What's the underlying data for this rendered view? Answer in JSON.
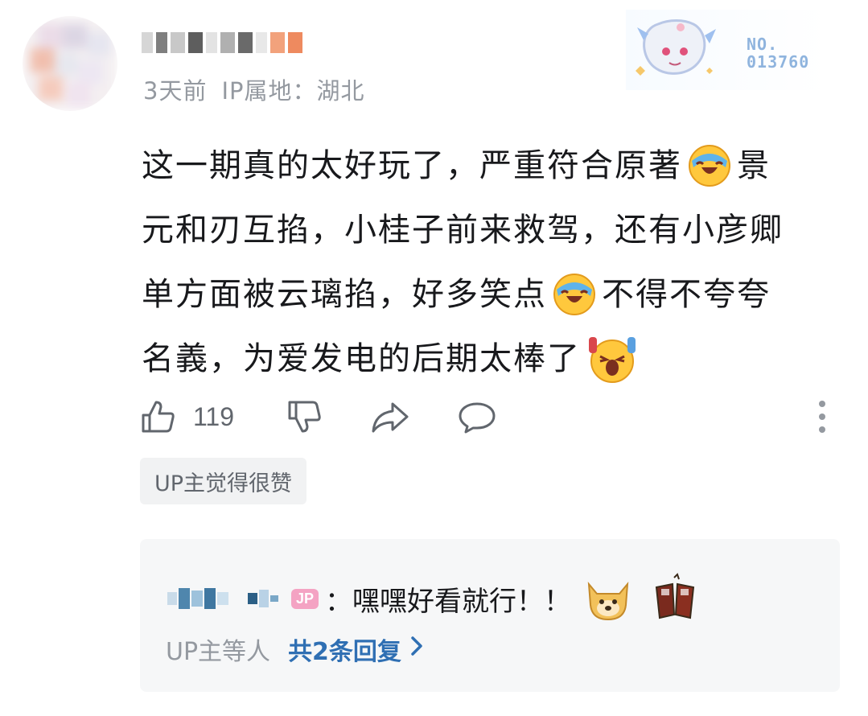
{
  "comment": {
    "time": "3天前",
    "ip_location": "IP属地：湖北",
    "fan_badge_no": "NO.\n013760",
    "lines": [
      {
        "pre": "这一期真的太好玩了，严重符合原著",
        "emoji": "laugh-cry",
        "post": "景"
      },
      {
        "pre": "元和刃互掐，小桂子前来救驾，还有小彦卿",
        "emoji": "",
        "post": ""
      },
      {
        "pre": "单方面被云璃掐，好多笑点",
        "emoji": "laugh-cry",
        "post": "不得不夸夸"
      },
      {
        "pre": "名義，为爱发电的后期太棒了",
        "emoji": "cheering",
        "post": ""
      }
    ],
    "like_count": "119",
    "up_tag": "UP主觉得很赞"
  },
  "reply": {
    "badge": "JP",
    "text": "：嘿嘿好看就行！！",
    "footer_who": "UP主等人",
    "footer_count": "共2条回复",
    "footer_chevron": "›"
  },
  "icons": {
    "like": "thumbs-up-icon",
    "dislike": "thumbs-down-icon",
    "share": "share-icon",
    "reply": "comment-icon",
    "more": "more-vertical-icon"
  },
  "colors": {
    "link": "#2f6fb3",
    "muted": "#9499a0",
    "reply_bg": "#f6f7f8"
  }
}
